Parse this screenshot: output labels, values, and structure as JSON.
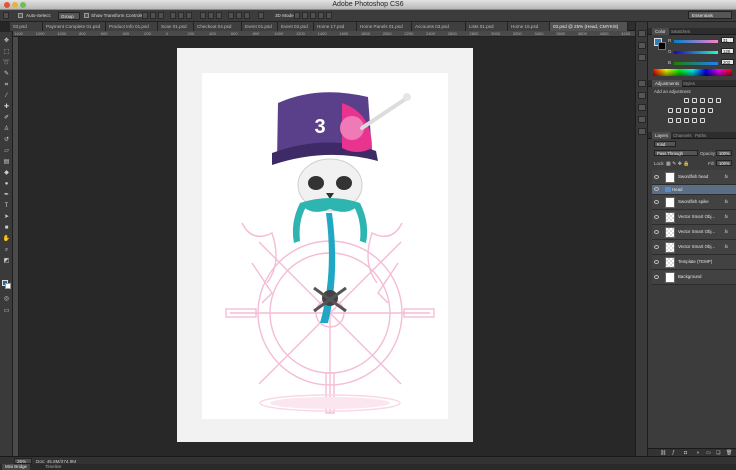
{
  "window": {
    "title": "Adobe Photoshop CS6"
  },
  "options_bar": {
    "auto_select_label": "Auto-Select:",
    "auto_select_value": "Group",
    "transform_label": "Show Transform Controls",
    "mode_3d_label": "3D Mode:",
    "workspace": "Essentials"
  },
  "tabs": [
    {
      "label": "03.psd"
    },
    {
      "label": "Payment Complete 01.psd"
    },
    {
      "label": "Product Info 01.psd"
    },
    {
      "label": "Scan 01.psd"
    },
    {
      "label": "Checkout 04.psd"
    },
    {
      "label": "Event 01.psd"
    },
    {
      "label": "Event 02.psd"
    },
    {
      "label": "Home 17.psd"
    },
    {
      "label": "Home Panels 01.psd"
    },
    {
      "label": "Accounts 03.psd"
    },
    {
      "label": "Lists 01.psd"
    },
    {
      "label": "Home 16.psd"
    },
    {
      "label": "03.psd @ 25% (Head, CMYK/8)"
    }
  ],
  "ruler_ticks": [
    "1400",
    "1200",
    "1000",
    "800",
    "600",
    "400",
    "200",
    "0",
    "200",
    "400",
    "600",
    "800",
    "1000",
    "1200",
    "1400",
    "1600",
    "1800",
    "2000",
    "2200",
    "2400",
    "2600",
    "2800",
    "3000",
    "3200",
    "3400",
    "3600",
    "3800",
    "4000",
    "4200"
  ],
  "color_panel": {
    "tabs": [
      "Color",
      "Swatches"
    ],
    "channels": [
      {
        "label": "R",
        "value": "31"
      },
      {
        "label": "G",
        "value": "128"
      },
      {
        "label": "B",
        "value": "203"
      }
    ],
    "fg_color": "#1f80cb"
  },
  "adjustments_panel": {
    "tabs": [
      "Adjustments",
      "Styles"
    ],
    "add_label": "Add an adjustment"
  },
  "layers_panel": {
    "tabs": [
      "Layers",
      "Channels",
      "Paths"
    ],
    "filter_kind": "Kind",
    "blend_mode": "Pass Through",
    "opacity_label": "Opacity:",
    "opacity_value": "100%",
    "lock_label": "Lock:",
    "fill_label": "Fill:",
    "fill_value": "100%",
    "fx_label": "fx",
    "layers": [
      {
        "name": "Swordfish head",
        "fx": true
      },
      {
        "name": "Head",
        "group": true
      },
      {
        "name": "Swordfish spike",
        "fx": true
      },
      {
        "name": "Vector Smart Obj...",
        "fx": true
      },
      {
        "name": "Vector Smart Obj...",
        "fx": true
      },
      {
        "name": "Vector Smart Obj...",
        "fx": true
      },
      {
        "name": "Template (TEMP)"
      },
      {
        "name": "Background"
      }
    ]
  },
  "status": {
    "zoom": "25%",
    "doc": "Doc: 45.8M/374.9M"
  },
  "bottom_tabs": [
    "Mini Bridge",
    "Timeline"
  ],
  "colors": {
    "accent": "#1f80cb",
    "hat_purple": "#5a3f8a",
    "pink": "#e8338f",
    "teal": "#2fb5b1",
    "wheel_pink": "#f4bcd6"
  }
}
